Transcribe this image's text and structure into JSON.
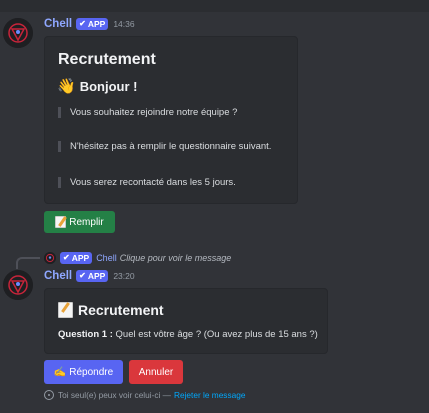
{
  "message1": {
    "username": "Chell",
    "app_tag": "APP",
    "timestamp": "14:36",
    "embed": {
      "title": "Recrutement",
      "subtitle": "Bonjour !",
      "quotes": [
        "Vous souhaitez rejoindre notre équipe ?",
        "N'hésitez pas à remplir le questionnaire suivant.",
        "Vous serez recontacté dans les 5 jours."
      ]
    },
    "button_label": "Remplir"
  },
  "reply": {
    "app_tag": "APP",
    "username": "Chell",
    "text": "Clique pour voir le message"
  },
  "message2": {
    "username": "Chell",
    "app_tag": "APP",
    "timestamp": "23:20",
    "embed": {
      "title": "Recrutement",
      "question_label": "Question 1 :",
      "question_text": "Quel est vôtre âge ? (Ou avez plus de 15 ans ?)"
    },
    "buttons": {
      "reply": "Répondre",
      "cancel": "Annuler"
    },
    "ephemeral": {
      "text": "Toi seul(e) peux voir celui-ci —",
      "dismiss": "Rejeter le message"
    }
  },
  "colors": {
    "background": "#313338",
    "embed": "#2b2d31",
    "username": "#8fa7ff",
    "blurple": "#5865f2",
    "green": "#248046",
    "red": "#da373c",
    "link": "#00a8fc"
  }
}
